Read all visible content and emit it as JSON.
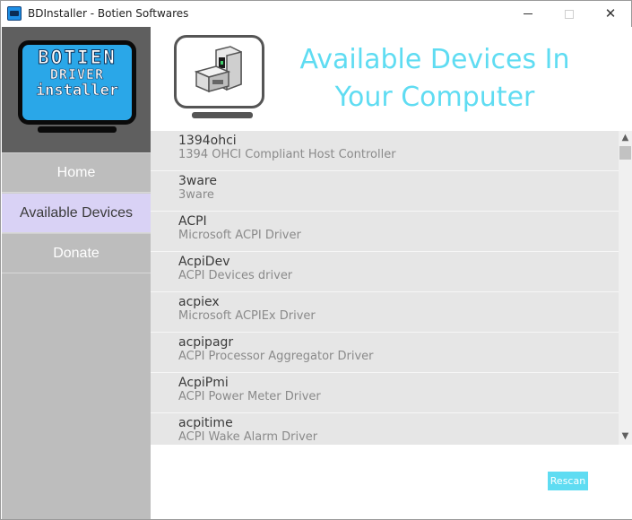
{
  "window": {
    "title": "BDInstaller - Botien Softwares"
  },
  "logo": {
    "line1": "BOTIEN",
    "line2": "DRIVER",
    "line3": "installer"
  },
  "sidebar": {
    "items": [
      {
        "label": "Home",
        "active": false
      },
      {
        "label": "Available Devices",
        "active": true
      },
      {
        "label": "Donate",
        "active": false
      }
    ]
  },
  "header": {
    "title": "Available Devices In Your Computer",
    "icon": "computer-icon"
  },
  "devices": [
    {
      "name": "1394ohci",
      "description": "1394 OHCI Compliant Host Controller"
    },
    {
      "name": "3ware",
      "description": "3ware"
    },
    {
      "name": "ACPI",
      "description": "Microsoft ACPI Driver"
    },
    {
      "name": "AcpiDev",
      "description": "ACPI Devices driver"
    },
    {
      "name": "acpiex",
      "description": "Microsoft ACPIEx Driver"
    },
    {
      "name": "acpipagr",
      "description": "ACPI Processor Aggregator Driver"
    },
    {
      "name": "AcpiPmi",
      "description": "ACPI Power Meter Driver"
    },
    {
      "name": "acpitime",
      "description": "ACPI Wake Alarm Driver"
    }
  ],
  "actions": {
    "rescan_label": "Rescan"
  },
  "colors": {
    "accent": "#5fdcf2",
    "sidebar_bg": "#bdbdbd",
    "active_nav_bg": "#d9d2f5",
    "logo_blue": "#2aa7e8",
    "list_bg": "#e6e6e6"
  }
}
